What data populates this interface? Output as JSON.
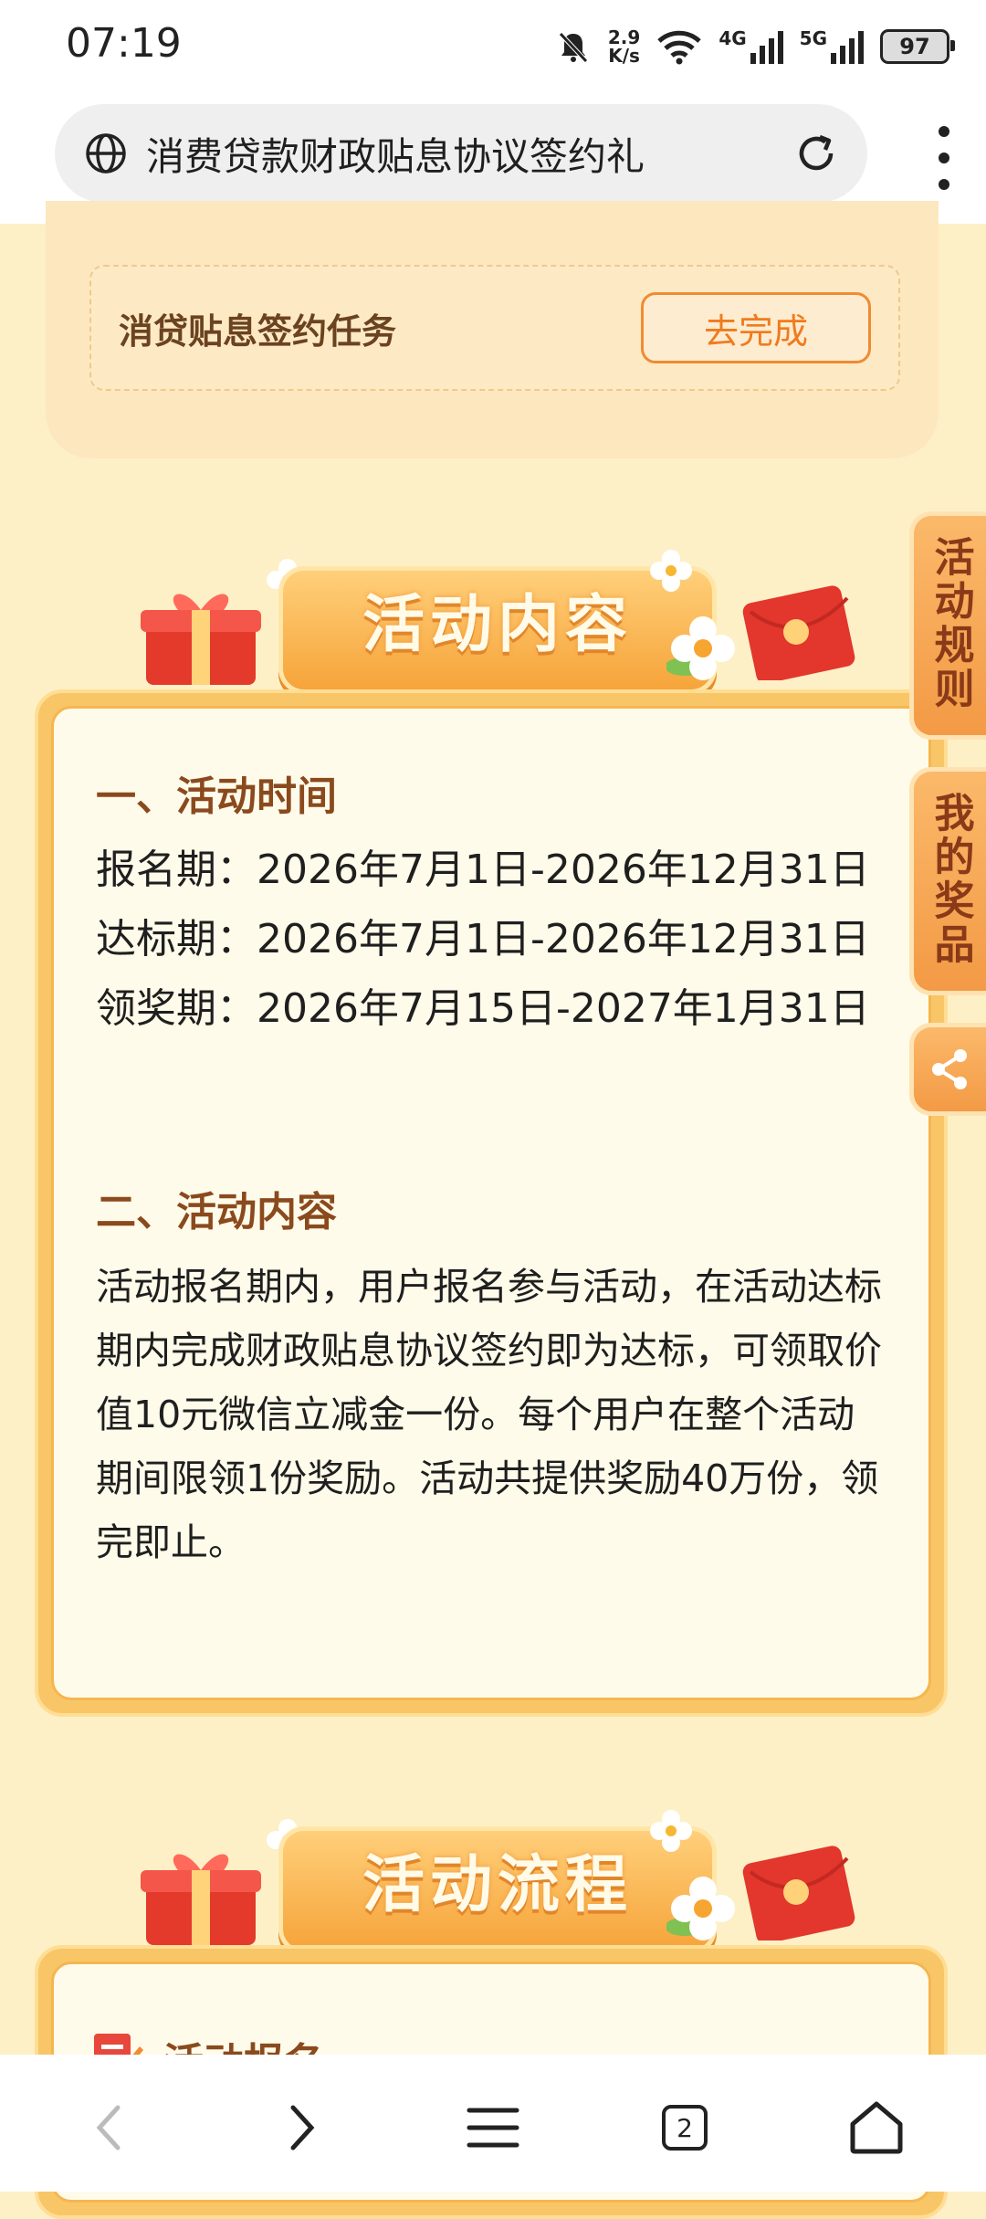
{
  "status_bar": {
    "time": "07:19",
    "net_speed_value": "2.9",
    "net_speed_unit": "K/s",
    "net_4g": "4G",
    "net_5g": "5G",
    "battery": "97"
  },
  "browser": {
    "url_title": "消费贷款财政贴息协议签约礼",
    "tab_count": "2"
  },
  "task": {
    "label": "消贷贴息签约任务",
    "button": "去完成"
  },
  "section1": {
    "banner": "活动内容",
    "time_heading": "一、活动时间",
    "periods": [
      {
        "label": "报名期",
        "sep": "：",
        "value": "2026年7月1日-2026年12月31日"
      },
      {
        "label": "达标期",
        "sep": "：",
        "value": "2026年7月1日-2026年12月31日"
      },
      {
        "label": "领奖期",
        "sep": "：",
        "value": "2026年7月15日-2027年1月31日"
      }
    ],
    "content_heading": "二、活动内容",
    "content_lines": [
      "活动报名期内，用户报名参与活动，在活动达标",
      "期内完成财政贴息协议签约即为达标，可领取价",
      "值10元微信立减金一份。每个用户在整个活动",
      "期间限领1份奖励。活动共提供奖励40万份，领",
      "完即止。"
    ]
  },
  "section2": {
    "banner": "活动流程",
    "first_item": "活动报名"
  },
  "side_tabs": {
    "rules": "活动规则",
    "prizes": "我的奖品"
  },
  "colors": {
    "page_bg": "#fdf0c6",
    "accent": "#f08b32",
    "heading": "#8a4a1d"
  }
}
